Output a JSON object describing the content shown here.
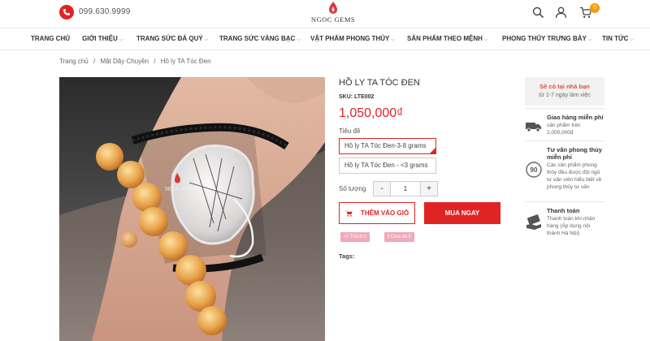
{
  "header": {
    "phone": "099.630.9999",
    "logo_text": "NGOC GEMS",
    "cart_count": "0"
  },
  "nav": {
    "items": [
      {
        "label": "TRANG CHỦ",
        "has_dropdown": false
      },
      {
        "label": "GIỚI THIỆU",
        "has_dropdown": true
      },
      {
        "label": "TRANG SỨC ĐÁ QUÝ",
        "has_dropdown": true
      },
      {
        "label": "TRANG SỨC VÀNG BẠC",
        "has_dropdown": true
      },
      {
        "label": "VẬT PHẨM PHONG THỦY",
        "has_dropdown": true
      },
      {
        "label": "SẢN PHẨM THEO MỆNH",
        "has_dropdown": true
      },
      {
        "label": "PHONG THỦY TRƯNG BÀY",
        "has_dropdown": true
      },
      {
        "label": "TIN TỨC",
        "has_dropdown": true
      }
    ]
  },
  "breadcrumb": {
    "home": "Trang chủ",
    "sep": "/",
    "category": "Mặt Dây Chuyền",
    "current": "Hồ ly TA Tóc Đen"
  },
  "product": {
    "image_watermark": "NGOC GEMS",
    "title": "HỒ LY TA TÓC ĐEN",
    "sku": "SKU: LTE002",
    "price": "1,050,000₫",
    "variant_label": "Tiêu đề",
    "variants": [
      "Hồ ly TA Tóc Đen-3-8 grams",
      "Hồ ly TA Tóc Đen - <3 grams"
    ],
    "selected_variant": 0,
    "qty_label": "Số lượng",
    "qty_minus": "-",
    "qty_value": "1",
    "qty_plus": "+",
    "add_to_cart": "THÊM VÀO GIỎ",
    "buy_now": "MUA NGAY",
    "like_label": "Thích 0",
    "share_label": "Chia sẻ 0",
    "tags_label": "Tags:"
  },
  "sidebar": {
    "shipping_title": "Sẽ có tại nhà bạn",
    "shipping_sub": "từ 1-7 ngày làm việc",
    "features": [
      {
        "icon": "truck-icon",
        "title": "Giao hàng miễn phí",
        "desc": "sản phẩm trên 2,000,000đ"
      },
      {
        "icon": "return-90-icon",
        "title": "Tư vấn phong thủy miễn phí",
        "desc": "Các sản phẩm phong thủy đều được đội ngũ tư vấn viên hiểu biết về phong thủy tư vấn"
      },
      {
        "icon": "payment-hand-icon",
        "title": "Thanh toán",
        "desc": "Thanh toán khi nhận hàng (Áp dụng nội thành Hà Nội)"
      }
    ]
  },
  "colors": {
    "accent": "#e02424",
    "badge": "#f39c12",
    "social": "#f1a8b8"
  }
}
